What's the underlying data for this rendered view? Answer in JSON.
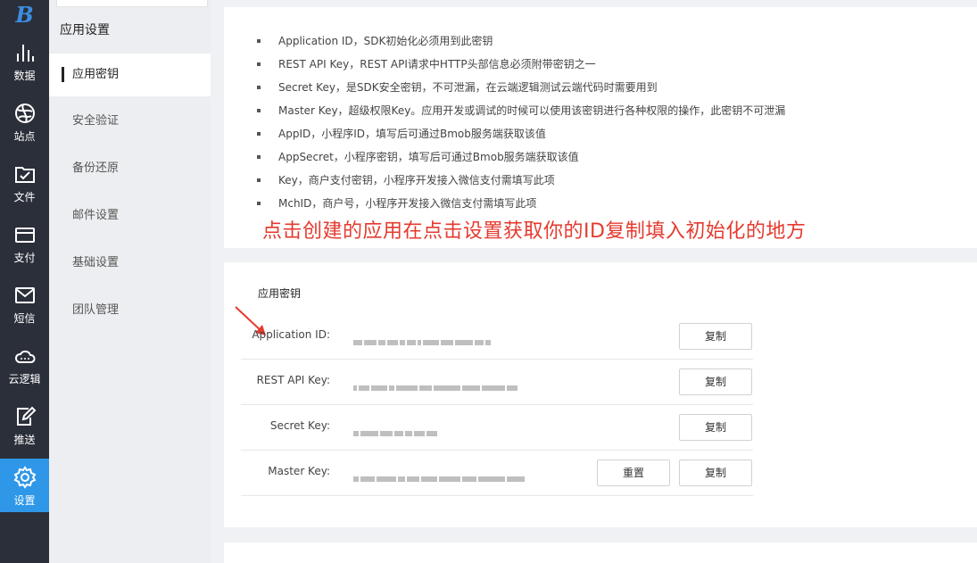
{
  "rail": {
    "logo": "B",
    "items": [
      {
        "label": "数据",
        "icon": "bar-chart-icon"
      },
      {
        "label": "站点",
        "icon": "globe-icon"
      },
      {
        "label": "文件",
        "icon": "folder-check-icon"
      },
      {
        "label": "支付",
        "icon": "card-icon"
      },
      {
        "label": "短信",
        "icon": "mail-icon"
      },
      {
        "label": "云逻辑",
        "icon": "cloud-icon"
      },
      {
        "label": "推送",
        "icon": "edit-icon"
      },
      {
        "label": "设置",
        "icon": "gear-icon"
      }
    ]
  },
  "sidebar": {
    "title": "应用设置",
    "items": [
      {
        "label": "应用密钥"
      },
      {
        "label": "安全验证"
      },
      {
        "label": "备份还原"
      },
      {
        "label": "邮件设置"
      },
      {
        "label": "基础设置"
      },
      {
        "label": "团队管理"
      }
    ]
  },
  "info": {
    "bullets": [
      "Application ID，SDK初始化必须用到此密钥",
      "REST API Key，REST API请求中HTTP头部信息必须附带密钥之一",
      "Secret Key，是SDK安全密钥，不可泄漏，在云端逻辑测试云端代码时需要用到",
      "Master Key，超级权限Key。应用开发或调试的时候可以使用该密钥进行各种权限的操作，此密钥不可泄漏",
      "AppID，小程序ID，填写后可通过Bmob服务端获取该值",
      "AppSecret，小程序密钥，填写后可通过Bmob服务端获取该值",
      "Key，商户支付密钥，小程序开发接入微信支付需填写此项",
      "MchID，商户号，小程序开发接入微信支付需填写此项"
    ],
    "annotation": "点击创建的应用在点击设置获取你的ID复制填入初始化的地方"
  },
  "keys": {
    "section_title": "应用密钥",
    "copy_label": "复制",
    "reset_label": "重置",
    "rows": [
      {
        "label": "Application ID:"
      },
      {
        "label": "REST API Key:"
      },
      {
        "label": "Secret Key:"
      },
      {
        "label": "Master Key:"
      }
    ]
  },
  "colors": {
    "rail_bg": "#2b2f3a",
    "active_blue": "#2f97e8",
    "annotation_red": "#e53a2f"
  }
}
